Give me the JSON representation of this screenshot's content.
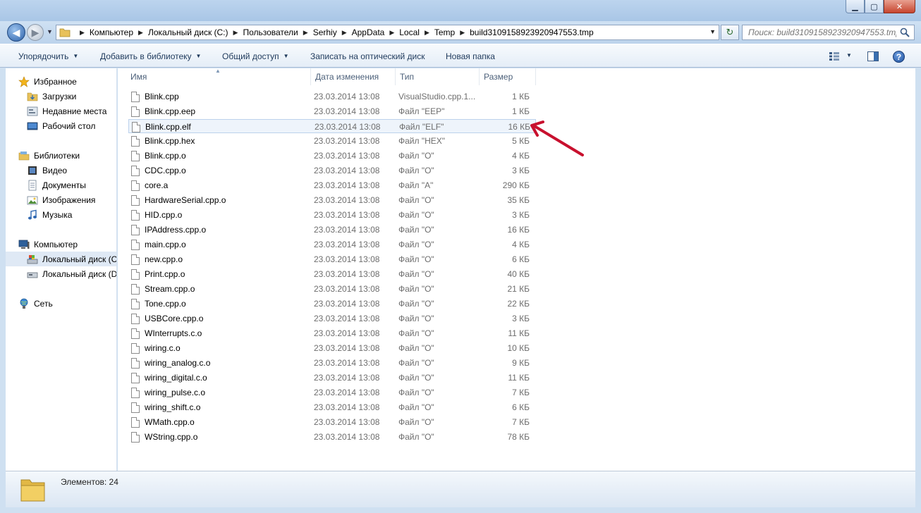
{
  "window": {
    "minimize_glyph": "▁",
    "maximize_glyph": "▢",
    "close_glyph": "✕"
  },
  "address": {
    "crumbs": [
      "Компьютер",
      "Локальный диск (C:)",
      "Пользователи",
      "Serhiy",
      "AppData",
      "Local",
      "Temp",
      "build3109158923920947553.tmp"
    ]
  },
  "search": {
    "placeholder": "Поиск: build3109158923920947553.tmp"
  },
  "toolbar": {
    "organize": "Упорядочить",
    "add_to_library": "Добавить в библиотеку",
    "share": "Общий доступ",
    "burn": "Записать на оптический диск",
    "new_folder": "Новая папка"
  },
  "sidebar": {
    "favorites": {
      "label": "Избранное",
      "items": [
        "Загрузки",
        "Недавние места",
        "Рабочий стол"
      ]
    },
    "libraries": {
      "label": "Библиотеки",
      "items": [
        "Видео",
        "Документы",
        "Изображения",
        "Музыка"
      ]
    },
    "computer": {
      "label": "Компьютер",
      "items": [
        "Локальный диск (C",
        "Локальный диск (D"
      ]
    },
    "network": {
      "label": "Сеть"
    }
  },
  "columns": {
    "name": "Имя",
    "date": "Дата изменения",
    "type": "Тип",
    "size": "Размер"
  },
  "files": [
    {
      "name": "Blink.cpp",
      "date": "23.03.2014 13:08",
      "type": "VisualStudio.cpp.1...",
      "size": "1 КБ"
    },
    {
      "name": "Blink.cpp.eep",
      "date": "23.03.2014 13:08",
      "type": "Файл \"EEP\"",
      "size": "1 КБ"
    },
    {
      "name": "Blink.cpp.elf",
      "date": "23.03.2014 13:08",
      "type": "Файл \"ELF\"",
      "size": "16 КБ"
    },
    {
      "name": "Blink.cpp.hex",
      "date": "23.03.2014 13:08",
      "type": "Файл \"HEX\"",
      "size": "5 КБ"
    },
    {
      "name": "Blink.cpp.o",
      "date": "23.03.2014 13:08",
      "type": "Файл \"O\"",
      "size": "4 КБ"
    },
    {
      "name": "CDC.cpp.o",
      "date": "23.03.2014 13:08",
      "type": "Файл \"O\"",
      "size": "3 КБ"
    },
    {
      "name": "core.a",
      "date": "23.03.2014 13:08",
      "type": "Файл \"A\"",
      "size": "290 КБ"
    },
    {
      "name": "HardwareSerial.cpp.o",
      "date": "23.03.2014 13:08",
      "type": "Файл \"O\"",
      "size": "35 КБ"
    },
    {
      "name": "HID.cpp.o",
      "date": "23.03.2014 13:08",
      "type": "Файл \"O\"",
      "size": "3 КБ"
    },
    {
      "name": "IPAddress.cpp.o",
      "date": "23.03.2014 13:08",
      "type": "Файл \"O\"",
      "size": "16 КБ"
    },
    {
      "name": "main.cpp.o",
      "date": "23.03.2014 13:08",
      "type": "Файл \"O\"",
      "size": "4 КБ"
    },
    {
      "name": "new.cpp.o",
      "date": "23.03.2014 13:08",
      "type": "Файл \"O\"",
      "size": "6 КБ"
    },
    {
      "name": "Print.cpp.o",
      "date": "23.03.2014 13:08",
      "type": "Файл \"O\"",
      "size": "40 КБ"
    },
    {
      "name": "Stream.cpp.o",
      "date": "23.03.2014 13:08",
      "type": "Файл \"O\"",
      "size": "21 КБ"
    },
    {
      "name": "Tone.cpp.o",
      "date": "23.03.2014 13:08",
      "type": "Файл \"O\"",
      "size": "22 КБ"
    },
    {
      "name": "USBCore.cpp.o",
      "date": "23.03.2014 13:08",
      "type": "Файл \"O\"",
      "size": "3 КБ"
    },
    {
      "name": "WInterrupts.c.o",
      "date": "23.03.2014 13:08",
      "type": "Файл \"O\"",
      "size": "11 КБ"
    },
    {
      "name": "wiring.c.o",
      "date": "23.03.2014 13:08",
      "type": "Файл \"O\"",
      "size": "10 КБ"
    },
    {
      "name": "wiring_analog.c.o",
      "date": "23.03.2014 13:08",
      "type": "Файл \"O\"",
      "size": "9 КБ"
    },
    {
      "name": "wiring_digital.c.o",
      "date": "23.03.2014 13:08",
      "type": "Файл \"O\"",
      "size": "11 КБ"
    },
    {
      "name": "wiring_pulse.c.o",
      "date": "23.03.2014 13:08",
      "type": "Файл \"O\"",
      "size": "7 КБ"
    },
    {
      "name": "wiring_shift.c.o",
      "date": "23.03.2014 13:08",
      "type": "Файл \"O\"",
      "size": "6 КБ"
    },
    {
      "name": "WMath.cpp.o",
      "date": "23.03.2014 13:08",
      "type": "Файл \"O\"",
      "size": "7 КБ"
    },
    {
      "name": "WString.cpp.o",
      "date": "23.03.2014 13:08",
      "type": "Файл \"O\"",
      "size": "78 КБ"
    }
  ],
  "selected_file": "Blink.cpp.elf",
  "status": {
    "items_count": "Элементов: 24"
  },
  "colors": {
    "annotation_arrow": "#c8102e",
    "selection": "#eef4fb",
    "accent": "#1e395b"
  }
}
